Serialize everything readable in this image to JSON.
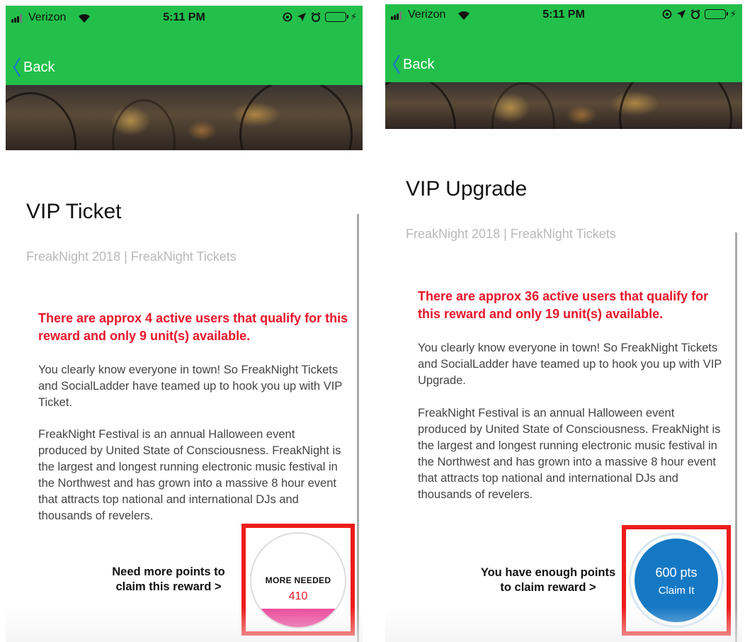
{
  "status_bar": {
    "carrier": "Verizon",
    "time": "5:11 PM"
  },
  "left": {
    "back_label": "Back",
    "title": "VIP Ticket",
    "subtitle": "FreakNight 2018 | FreakNight Tickets",
    "warning": "There are approx 4 active users that qualify for this reward and only 9 unit(s) available.",
    "description_1": "You clearly know everyone in town! So FreakNight Tickets and SocialLadder have teamed up to hook you up with VIP Ticket.",
    "description_2": "FreakNight Festival is an annual Halloween event produced by United State of Consciousness. FreakNight is the largest and longest running electronic music festival in the Northwest and has grown into a massive 8 hour event that attracts top national and international DJs and thousands of revelers.",
    "prompt_line1": "Need more points to",
    "prompt_line2": "claim this reward >",
    "more_needed_label": "MORE NEEDED",
    "more_needed_value": "410",
    "progress_fraction": 0.2
  },
  "right": {
    "back_label": "Back",
    "title": "VIP Upgrade",
    "subtitle": "FreakNight 2018 | FreakNight Tickets",
    "warning": "There are approx 36 active users that qualify for this reward and only 19 unit(s) available.",
    "description_1": "You clearly know everyone in town! So FreakNight Tickets and SocialLadder have teamed up to hook you up with VIP Upgrade.",
    "description_2": "FreakNight Festival is an annual Halloween event produced by United State of Consciousness. FreakNight is the largest and longest running electronic music festival in the Northwest and has grown into a massive 8 hour event that attracts top national and international DJs and thousands of revelers.",
    "prompt_line1": "You have enough points",
    "prompt_line2": "to claim reward >",
    "points": "600 pts",
    "claim_label": "Claim It"
  },
  "colors": {
    "nav_green": "#22c04a",
    "warning_red": "#e8162a",
    "highlight_red": "#ee1b1b",
    "claim_blue": "#1478c4",
    "progress_pink": "#ec4a9c"
  },
  "icons": [
    "signal-icon",
    "wifi-icon",
    "screen-lock-icon",
    "location-arrow-icon",
    "alarm-icon",
    "battery-icon",
    "charging-bolt-icon",
    "chevron-left-icon"
  ]
}
